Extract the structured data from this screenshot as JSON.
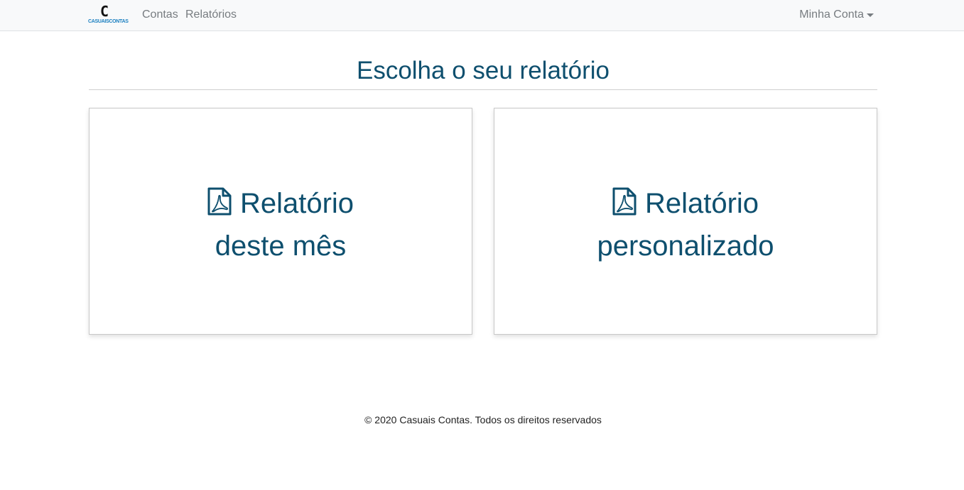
{
  "navbar": {
    "brand": {
      "logo_letter": "C",
      "logo_text": "CASUAISCONTAS"
    },
    "links": [
      {
        "label": "Contas"
      },
      {
        "label": "Relatórios"
      }
    ],
    "account_label": "Minha Conta"
  },
  "main": {
    "title": "Escolha o seu relatório",
    "cards": [
      {
        "line1": "Relatório",
        "line2": "deste mês",
        "icon": "file-pdf-icon"
      },
      {
        "line1": "Relatório",
        "line2": "personalizado",
        "icon": "file-pdf-icon"
      }
    ]
  },
  "footer": {
    "text": "© 2020 Casuais Contas. Todos os direitos reservados"
  },
  "colors": {
    "accent": "#0e4f6e",
    "navbar_bg": "#f8f9fa",
    "nav_text": "#777c80",
    "logo_blue": "#1a7fc0"
  }
}
